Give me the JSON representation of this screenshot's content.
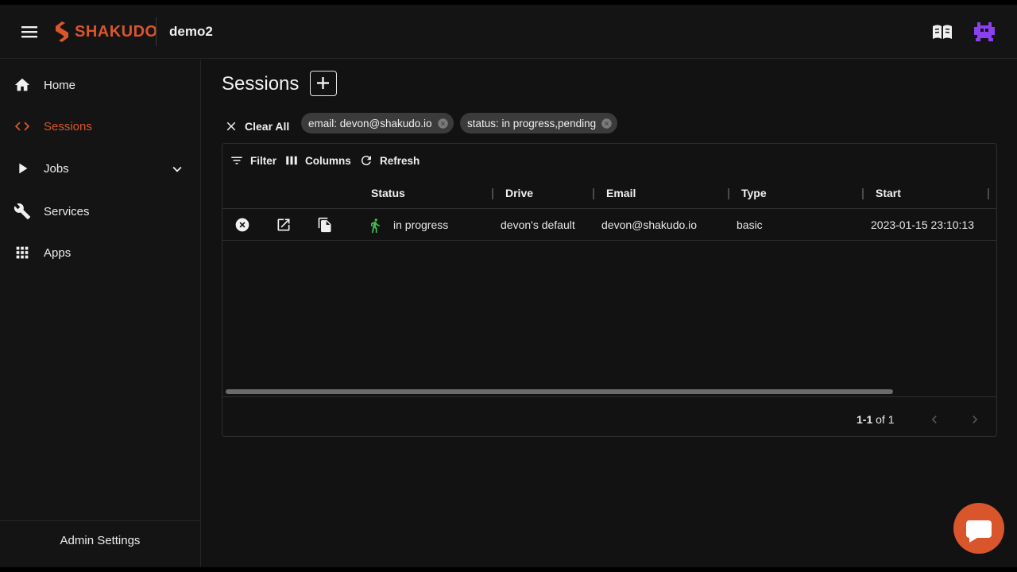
{
  "header": {
    "brand": "SHAKUDO",
    "workspace": "demo2"
  },
  "sidebar": {
    "items": [
      {
        "label": "Home",
        "icon": "home-icon"
      },
      {
        "label": "Sessions",
        "icon": "code-icon",
        "active": true
      },
      {
        "label": "Jobs",
        "icon": "play-icon"
      },
      {
        "label": "Services",
        "icon": "wrench-icon"
      },
      {
        "label": "Apps",
        "icon": "apps-grid-icon"
      }
    ],
    "admin_label": "Admin Settings"
  },
  "main": {
    "title": "Sessions",
    "clear_all_label": "Clear All",
    "filters": [
      {
        "label": "email: devon@shakudo.io"
      },
      {
        "label": "status: in progress,pending"
      }
    ],
    "toolbar": {
      "filter_label": "Filter",
      "columns_label": "Columns",
      "refresh_label": "Refresh"
    },
    "columns": [
      "Status",
      "Drive",
      "Email",
      "Type",
      "Start"
    ],
    "rows": [
      {
        "status": "in progress",
        "drive": "devon's default",
        "email": "devon@shakudo.io",
        "type": "basic",
        "start": "2023-01-15 23:10:13"
      }
    ],
    "pagination": {
      "range": "1-1",
      "of_label": "of 1"
    }
  },
  "colors": {
    "accent": "#d9552b",
    "background": "#121212",
    "status_running": "#3fbf4f",
    "avatar": "#8a3ff0"
  }
}
